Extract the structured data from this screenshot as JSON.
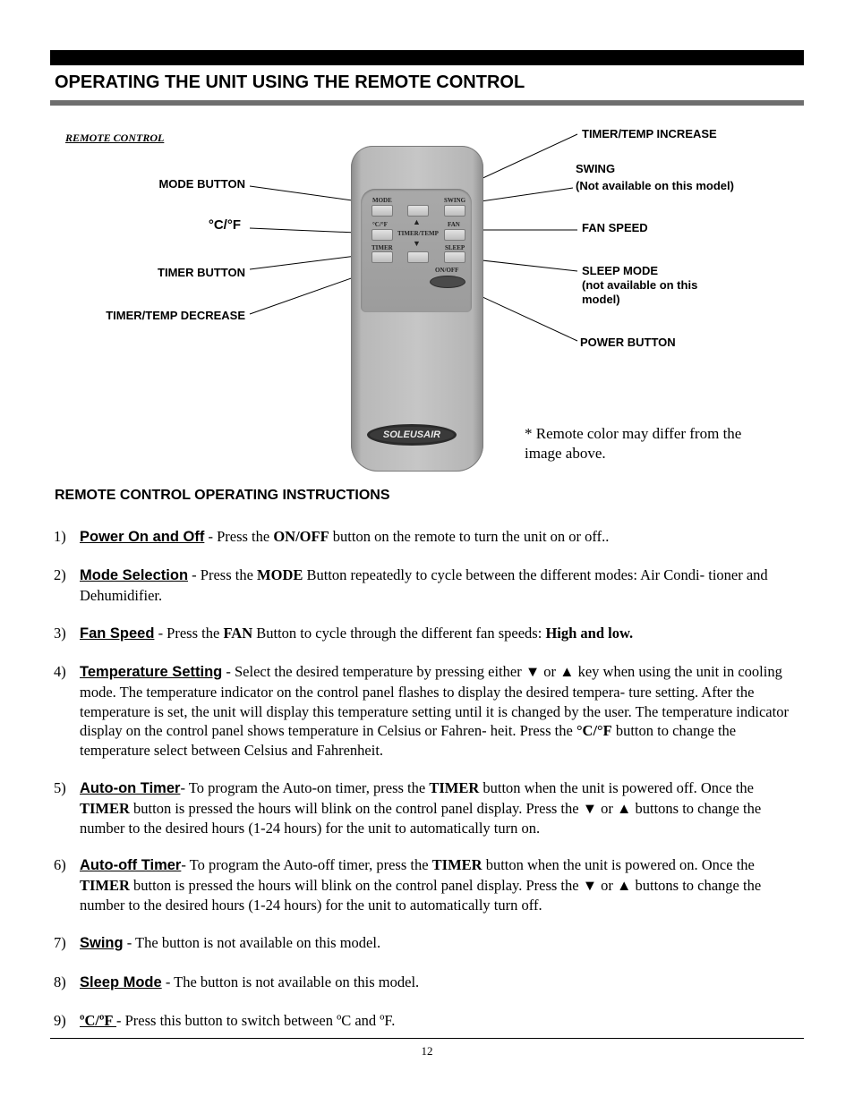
{
  "header": {
    "title": "OPERATING THE UNIT USING THE REMOTE CONTROL"
  },
  "figure": {
    "caption": "REMOTE CONTROL",
    "callouts_left": {
      "mode": "MODE BUTTON",
      "cf": "°C/°F",
      "timer": "TIMER BUTTON",
      "decrease": "TIMER/TEMP DECREASE"
    },
    "callouts_right": {
      "increase": "TIMER/TEMP INCREASE",
      "swing_title": "SWING",
      "swing_note": "(Not available on this model)",
      "fan": "FAN SPEED",
      "sleep_title": "SLEEP MODE",
      "sleep_note_1": "(not available on this",
      "sleep_note_2": "model)",
      "power": "POWER BUTTON"
    },
    "remote_labels": {
      "mode": "MODE",
      "swing": "SWING",
      "cf": "°C/°F",
      "up_arrow": "▲",
      "timer_temp": "TIMER/TEMP",
      "down_arrow": "▼",
      "fan": "FAN",
      "timer": "TIMER",
      "sleep": "SLEEP",
      "onoff": "ON/OFF",
      "brand": "SOLEUSAIR"
    },
    "note_line_1": "* Remote color may differ from the",
    "note_line_2": "image above."
  },
  "instructions": {
    "title": "REMOTE CONTROL OPERATING INSTRUCTIONS",
    "items": [
      {
        "num": "1)",
        "head": "Power On and Off",
        "t1": " - Press the ",
        "b1": "ON/OFF",
        "t2": "  button on the remote to turn the unit on or off.."
      },
      {
        "num": "2)",
        "head": "Mode Selection",
        "t1": " - Press the ",
        "b1": "MODE",
        "t2": " Button repeatedly to cycle between the different modes: Air Condi- tioner and Dehumidifier."
      },
      {
        "num": "3)",
        "head": "Fan Speed",
        "t1": " - Press the ",
        "b1": "FAN",
        "t2": " Button to cycle through the different fan speeds: ",
        "b2": "High and low."
      },
      {
        "num": "4)",
        "head": "Temperature Setting",
        "t1": " - Select the desired temperature by pressing either ▼ or ▲ key when using the unit in cooling mode. The temperature indicator on the control panel flashes to display the desired tempera- ture setting. After the temperature is set, the unit will display this temperature setting until it is changed by the user. The temperature indicator display on the control panel shows temperature in Celsius or Fahren- heit.  Press the  ",
        "b1": "°C/°F",
        "t2": "  button to change the temperature select between  Celsius and Fahrenheit."
      },
      {
        "num": "5)",
        "head": "Auto-on Timer",
        "t1": "- To program the Auto-on timer,  press the ",
        "b1": "TIMER",
        "t2": " button when the unit is powered off. Once the ",
        "b2": "TIMER",
        "t3": " button is pressed the hours will blink on the control panel display. Press the ▼ or ▲ buttons to change the number to the desired hours (1-24 hours) for the unit to automatically turn on."
      },
      {
        "num": "6)",
        "head": "Auto-off Timer",
        "t1": "- To program the Auto-off timer,  press the ",
        "b1": "TIMER",
        "t2": " button when the unit is powered on. Once the ",
        "b2": "TIMER",
        "t3": " button is pressed the hours will blink on the control panel display. Press the ▼ or ▲ buttons to change the number to the desired hours (1-24 hours) for the unit to automatically turn off."
      },
      {
        "num": "7)",
        "head": "Swing",
        "t1": " - The button is not available on this model."
      },
      {
        "num": "8)",
        "head": "Sleep Mode",
        "t1": " - The button is not available on this model."
      },
      {
        "num": "9)",
        "head": "ºC/ºF ",
        "t1": "- Press this button to switch between ºC and ºF."
      }
    ]
  },
  "footer": {
    "page_number": "12"
  }
}
